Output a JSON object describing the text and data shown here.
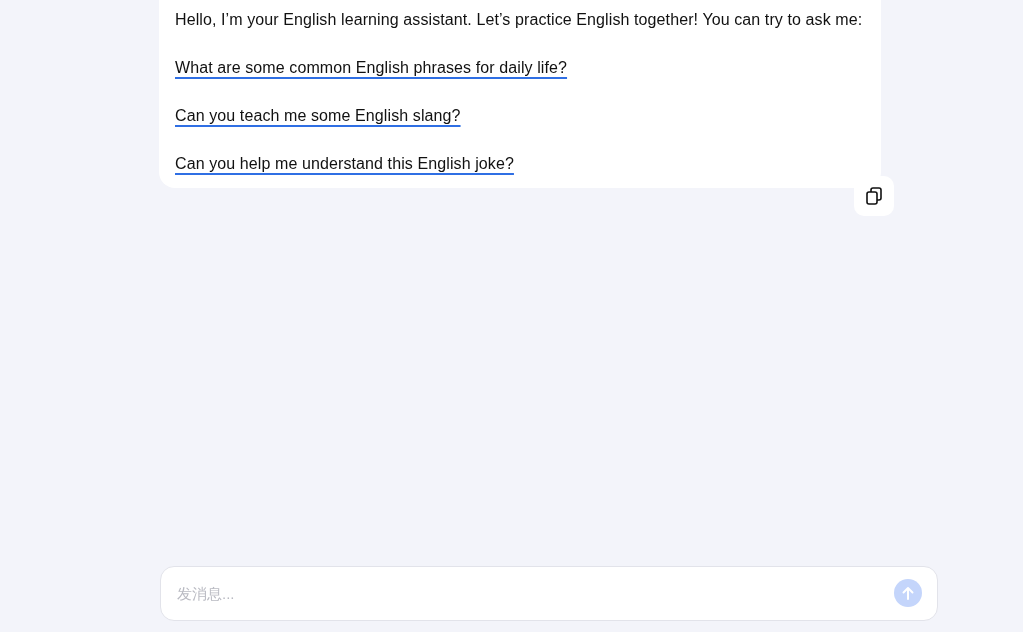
{
  "message": {
    "text": "Hello, I’m your English learning assistant. Let’s practice English together! You can try to ask me:",
    "suggestions": [
      "What are some common English phrases for daily life?",
      "Can you teach me some English slang?",
      "Can you help me understand this English joke?"
    ]
  },
  "composer": {
    "placeholder": "发消息...",
    "send_disabled": true
  }
}
